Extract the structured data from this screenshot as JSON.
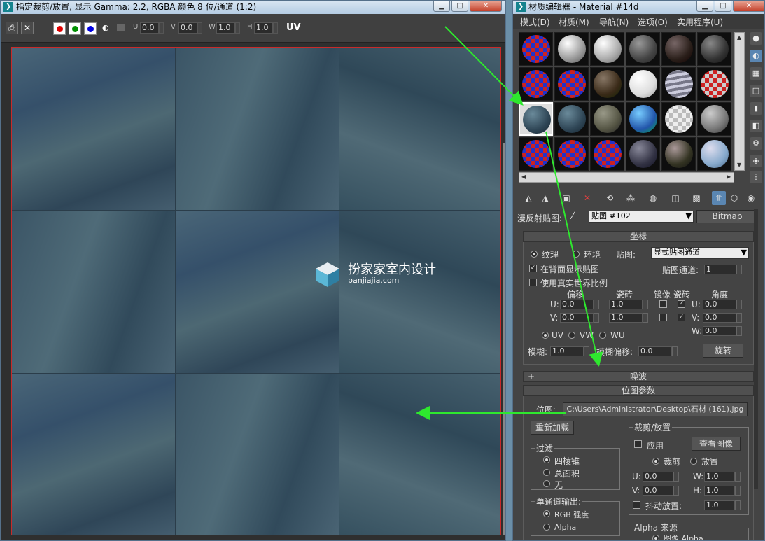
{
  "left_window": {
    "title": "指定裁剪/放置, 显示 Gamma: 2.2, RGBA 颜色 8 位/通道 (1:2)",
    "toolbar": {
      "u_label": "U",
      "u_value": "0.0",
      "v_label": "V",
      "v_value": "0.0",
      "w_label": "W",
      "w_value": "1.0",
      "h_label": "H",
      "h_value": "1.0",
      "uv_label": "UV"
    },
    "watermark": {
      "title": "扮家家室内设计",
      "url": "banjiajia.com"
    }
  },
  "right_window": {
    "title": "材质编辑器 - Material #14d",
    "menu": [
      "模式(D)",
      "材质(M)",
      "导航(N)",
      "选项(O)",
      "实用程序(U)"
    ],
    "diffuse_map": {
      "label": "漫反射贴图:",
      "map_name": "贴图 #102",
      "type_button": "Bitmap"
    },
    "coordinates": {
      "title": "坐标",
      "texture_label": "纹理",
      "environ_label": "环境",
      "mapping_label": "贴图:",
      "mapping_value": "显式贴图通道",
      "show_back": "在背面显示贴图",
      "map_channel_label": "贴图通道:",
      "map_channel_value": "1",
      "real_world": "使用真实世界比例",
      "col_offset": "偏移",
      "col_tiling": "瓷砖",
      "col_mirror": "镜像",
      "col_tile": "瓷砖",
      "col_angle": "角度",
      "u_label": "U:",
      "v_label": "V:",
      "w_label": "W:",
      "u_offset": "0.0",
      "v_offset": "0.0",
      "u_tiling": "1.0",
      "v_tiling": "1.0",
      "u_angle": "0.0",
      "v_angle": "0.0",
      "w_angle": "0.0",
      "uv": "UV",
      "vw": "VW",
      "wu": "WU",
      "blur_label": "模糊:",
      "blur_value": "1.0",
      "blur_offset_label": "模糊偏移:",
      "blur_offset_value": "0.0",
      "rotate_button": "旋转"
    },
    "noise": {
      "title": "噪波"
    },
    "bitmap_params": {
      "title": "位图参数",
      "bitmap_label": "位图:",
      "bitmap_path": "C:\\Users\\Administrator\\Desktop\\石材 (161).jpg",
      "reload_button": "重新加载",
      "filter_title": "过滤",
      "filter_pyramidal": "四棱锥",
      "filter_sat": "总面积",
      "filter_none": "无",
      "mono_title": "单通道输出:",
      "mono_rgb": "RGB 强度",
      "mono_alpha": "Alpha",
      "crop_title": "裁剪/放置",
      "apply_label": "应用",
      "view_image_button": "查看图像",
      "crop_label": "裁剪",
      "place_label": "放置",
      "u_label": "U:",
      "u_value": "0.0",
      "v_label": "V:",
      "v_value": "0.0",
      "w_label": "W:",
      "w_value": "1.0",
      "h_label": "H:",
      "h_value": "1.0",
      "jitter_label": "抖动放置:",
      "jitter_value": "1.0",
      "alpha_source_title": "Alpha 来源",
      "alpha_image": "图像 Alpha"
    }
  },
  "colors": {
    "annotation_arrow": "#2ee82e",
    "selection": "#5a86b2"
  }
}
